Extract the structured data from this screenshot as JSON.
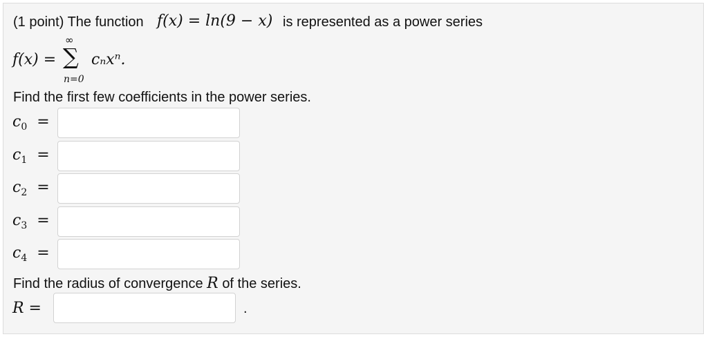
{
  "problem": {
    "points": "(1 point) The function",
    "function_math": "f(x) = ln(9 − x)",
    "intro_tail": "is represented as a power series",
    "series": {
      "lhs": "f(x) =",
      "sigma": "∑",
      "upper": "∞",
      "lower": "n=0",
      "term": "cₙxⁿ."
    },
    "coeff_prompt": "Find the first few coefficients in the power series.",
    "coefficients": [
      {
        "label": "c",
        "index": "0",
        "eq": "=",
        "value": ""
      },
      {
        "label": "c",
        "index": "1",
        "eq": "=",
        "value": ""
      },
      {
        "label": "c",
        "index": "2",
        "eq": "=",
        "value": ""
      },
      {
        "label": "c",
        "index": "3",
        "eq": "=",
        "value": ""
      },
      {
        "label": "c",
        "index": "4",
        "eq": "=",
        "value": ""
      }
    ],
    "radius_prompt_a": "Find the radius of convergence",
    "radius_symbol": "R",
    "radius_prompt_b": "of the series.",
    "radius_label": "R =",
    "radius_value": "",
    "radius_period": "."
  }
}
